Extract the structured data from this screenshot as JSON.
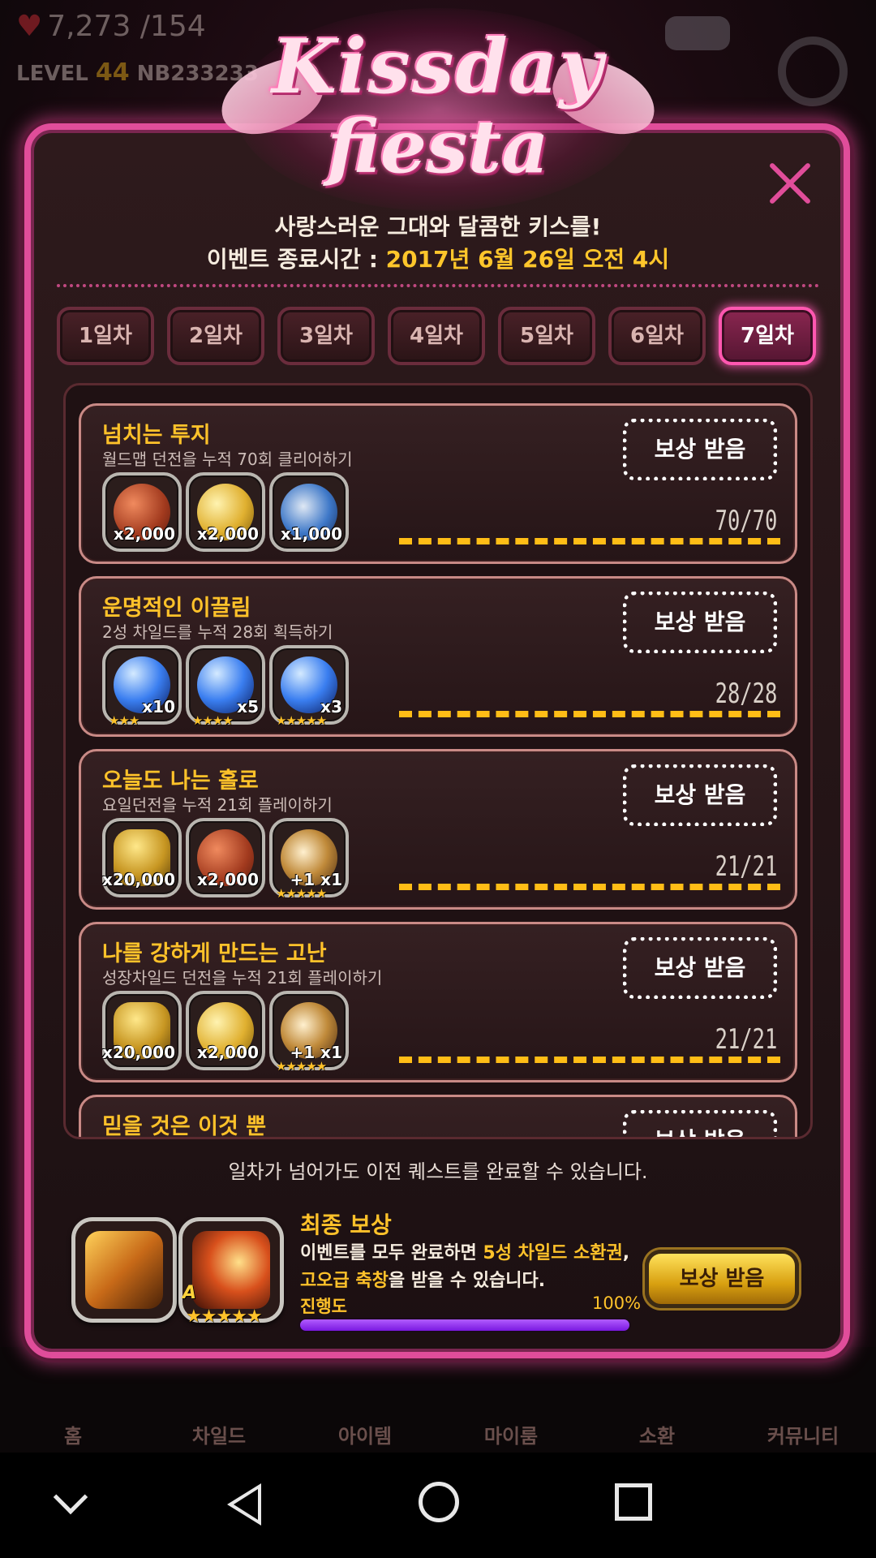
{
  "hud": {
    "hearts": "7,273 /154",
    "level_label": "LEVEL",
    "level": "44",
    "player_id": "NB233233"
  },
  "bottom_nav": [
    "홈",
    "차일드",
    "아이템",
    "마이룸",
    "소환",
    "커뮤니티"
  ],
  "event": {
    "logo_line1": "Kissday",
    "logo_line2": "fiesta",
    "subtitle": "사랑스러운 그대와 달콤한 키스를!",
    "end_label": "이벤트 종료시간 : ",
    "end_time": "2017년 6월 26일 오전 4시"
  },
  "tabs": [
    "1일차",
    "2일차",
    "3일차",
    "4일차",
    "5일차",
    "6일차",
    "7일차"
  ],
  "active_tab": "7일차",
  "quests": [
    {
      "title": "넘치는 투지",
      "desc": "월드맵 던전을 누적 70회 클리어하기",
      "button": "보상 받음",
      "progress": "70/70",
      "items": [
        {
          "icon": "red-coin-icon",
          "qty": "x2,000"
        },
        {
          "icon": "gold-coin-icon",
          "qty": "x2,000"
        },
        {
          "icon": "blue-wing-medal-icon",
          "qty": "x1,000"
        }
      ]
    },
    {
      "title": "운명적인 이끌림",
      "desc": "2성 차일드를 누적 28회 획득하기",
      "button": "보상 받음",
      "progress": "28/28",
      "items": [
        {
          "icon": "blue-gem-icon",
          "qty": "x10",
          "stars": "★★★"
        },
        {
          "icon": "blue-gem-icon",
          "qty": "x5",
          "stars": "★★★★"
        },
        {
          "icon": "blue-gem-icon",
          "qty": "x3",
          "stars": "★★★★★"
        }
      ]
    },
    {
      "title": "오늘도 나는 홀로",
      "desc": "요일던전을 누적 21회 플레이하기",
      "button": "보상 받음",
      "progress": "21/21",
      "items": [
        {
          "icon": "gold-coins-pile-icon",
          "qty": "x20,000"
        },
        {
          "icon": "red-coin-icon",
          "qty": "x2,000"
        },
        {
          "icon": "ring-orb-icon",
          "qty": "+1 x1",
          "stars": "★★★★★"
        }
      ]
    },
    {
      "title": "나를 강하게 만드는 고난",
      "desc": "성장차일드 던전을 누적 21회 플레이하기",
      "button": "보상 받음",
      "progress": "21/21",
      "items": [
        {
          "icon": "gold-coins-pile-icon",
          "qty": "x20,000"
        },
        {
          "icon": "gold-coin-icon",
          "qty": "x2,000"
        },
        {
          "icon": "ring-orb-icon",
          "qty": "+1 x1",
          "stars": "★★★★★"
        }
      ]
    },
    {
      "title": "믿을 것은 이것 뿐",
      "desc": "",
      "button": "보상 받음",
      "progress": "",
      "items": []
    }
  ],
  "hint": "일차가 넘어가도 이전 퀘스트를 완료할 수 있습니다.",
  "final_reward": {
    "title": "최종 보상",
    "desc_pre": "이벤트를 모두 완료하면 ",
    "desc_hl1": "5성 차일드 소환권",
    "desc_mid": ",",
    "desc_hl2": "고오급 축창",
    "desc_post": "을 받을 수 있습니다.",
    "progress_label": "진행도",
    "progress_pct": "100%",
    "progress_value": 1.0,
    "item2_tag": "A",
    "item2_stars": "★★★★★",
    "claim_button": "보상 받음"
  },
  "colors": {
    "accent_pink": "#e04d9a",
    "gold_text": "#ffc22a",
    "progress_purple": "#8a2be2"
  }
}
